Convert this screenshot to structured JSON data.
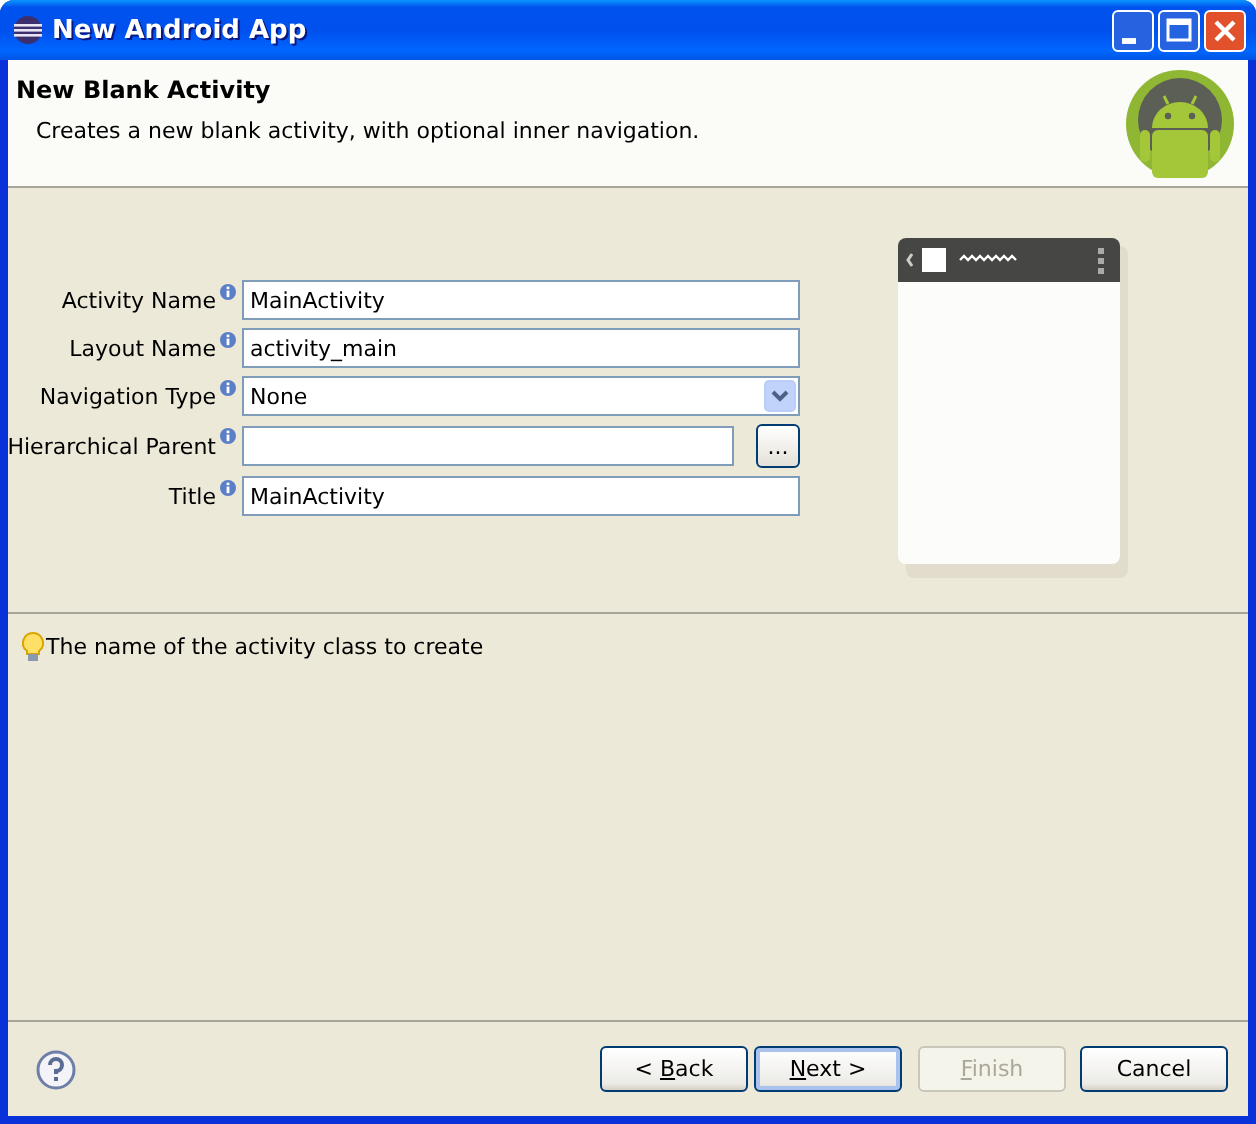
{
  "window": {
    "title": "New Android App"
  },
  "header": {
    "title": "New Blank Activity",
    "description": "Creates a new blank activity, with optional inner navigation."
  },
  "fields": [
    {
      "kind": "text",
      "label": "Activity Name",
      "value": "MainActivity"
    },
    {
      "kind": "text",
      "label": "Layout Name",
      "value": "activity_main"
    },
    {
      "kind": "combo",
      "label": "Navigation Type",
      "value": "None"
    },
    {
      "kind": "browse",
      "label": "Hierarchical Parent",
      "button": "..."
    },
    {
      "kind": "text",
      "label": "Title",
      "value": "MainActivity"
    }
  ],
  "hint": "The name of the activity class to create",
  "buttons": [
    {
      "label_before": "< ",
      "mnemonic": "B",
      "label_after": "ack",
      "disabled": false,
      "default": false
    },
    {
      "mnemonic": "N",
      "label_after": "ext >",
      "disabled": false,
      "default": true
    },
    {
      "mnemonic": "F",
      "label_after": "inish",
      "disabled": true,
      "default": false
    },
    {
      "label": "Cancel",
      "disabled": false,
      "default": false
    }
  ]
}
